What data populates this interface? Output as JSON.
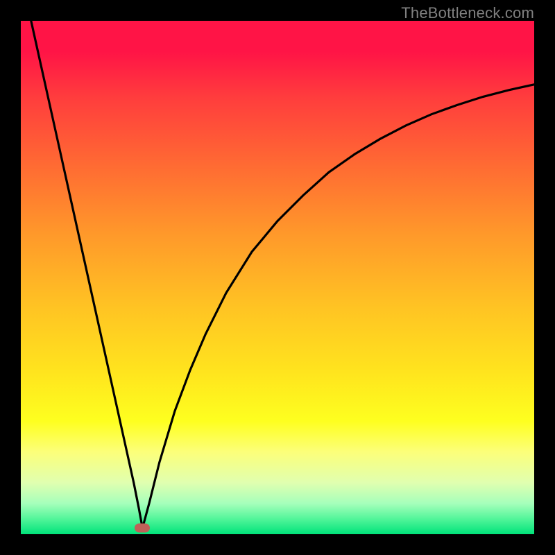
{
  "attribution": "TheBottleneck.com",
  "colors": {
    "page_bg": "#000000",
    "gradient_top": "#ff1446",
    "gradient_bottom": "#00e37a",
    "curve": "#000000",
    "marker": "#c06058",
    "attribution_text": "#808080"
  },
  "chart_data": {
    "type": "line",
    "title": "",
    "xlabel": "",
    "ylabel": "",
    "xlim": [
      0,
      100
    ],
    "ylim": [
      0,
      100
    ],
    "grid": false,
    "legend": false,
    "series": [
      {
        "name": "left-branch",
        "x": [
          2,
          4,
          6,
          8,
          10,
          12,
          14,
          16,
          18,
          20,
          22,
          23,
          23.7
        ],
        "values": [
          100,
          91,
          82,
          73,
          64,
          55,
          46,
          37,
          28,
          19,
          10,
          5,
          1.2
        ]
      },
      {
        "name": "right-branch",
        "x": [
          23.7,
          25,
          27,
          30,
          33,
          36,
          40,
          45,
          50,
          55,
          60,
          65,
          70,
          75,
          80,
          85,
          90,
          95,
          100
        ],
        "values": [
          1.2,
          6,
          14,
          24,
          32,
          39,
          47,
          55,
          61,
          66,
          70.5,
          74,
          77,
          79.6,
          81.8,
          83.6,
          85.2,
          86.5,
          87.6
        ]
      }
    ],
    "marker": {
      "x": 23.7,
      "y": 1.2
    }
  }
}
